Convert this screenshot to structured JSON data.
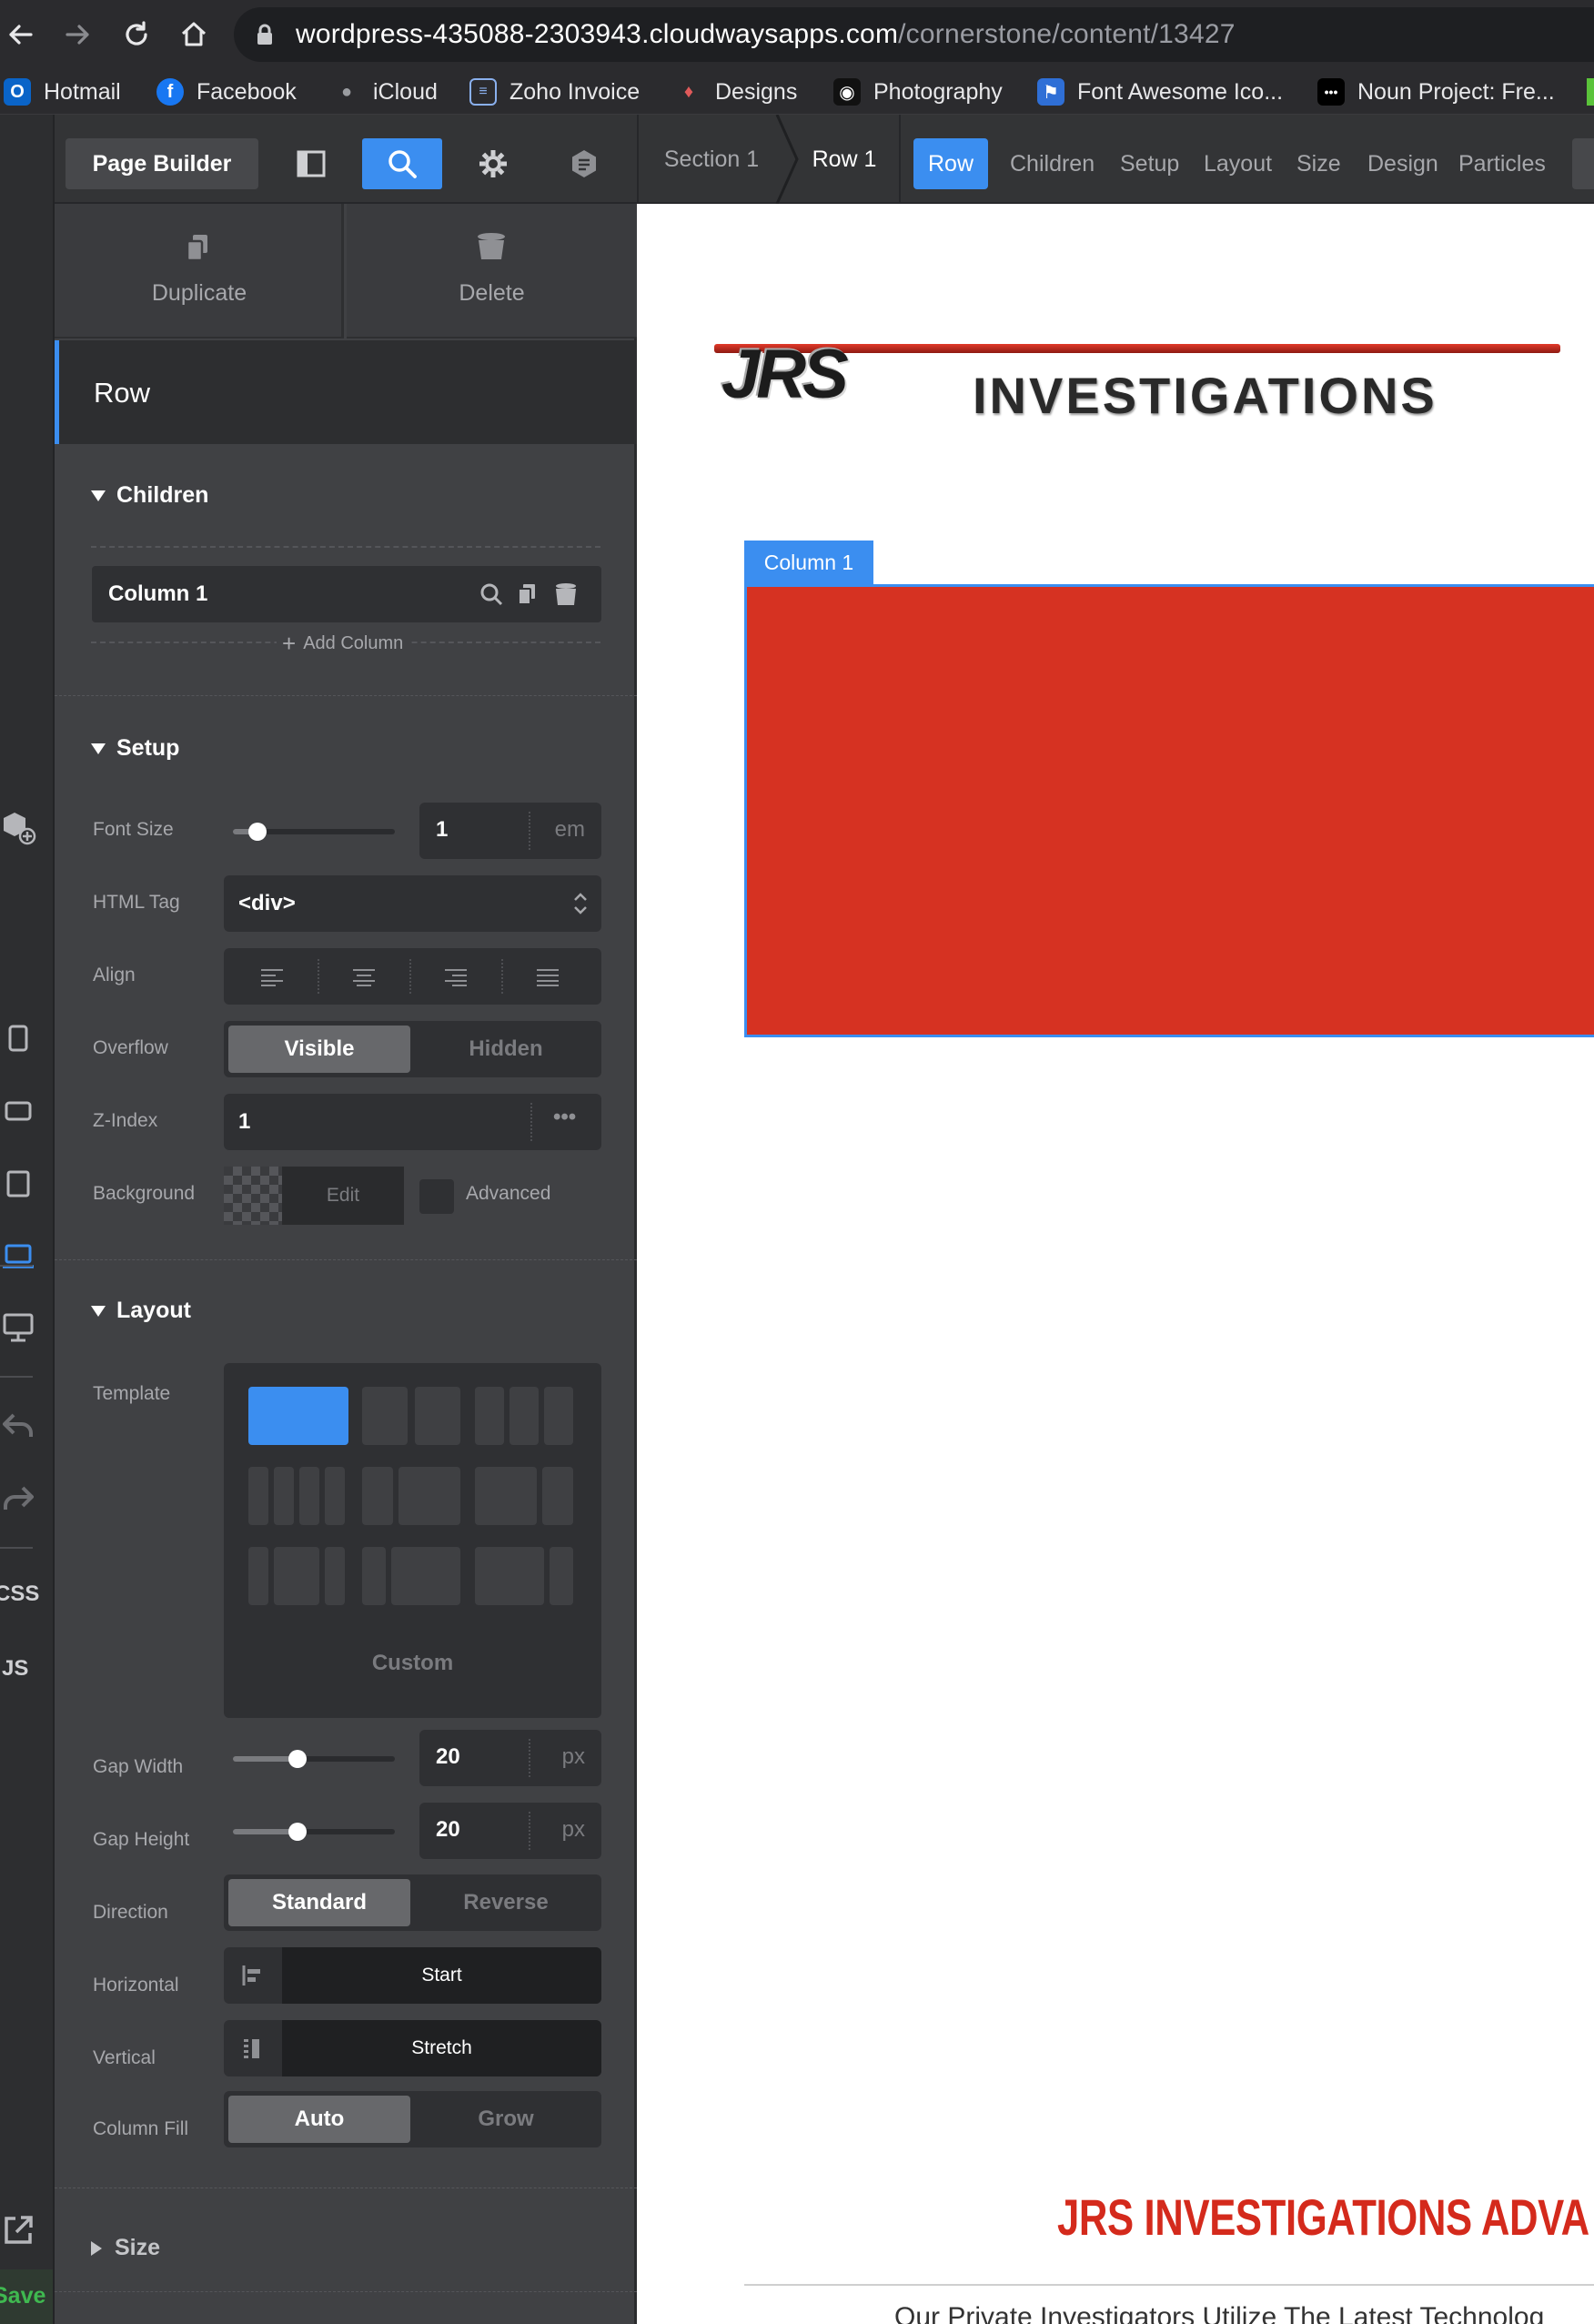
{
  "browser": {
    "url_host": "wordpress-435088-2303943.cloudwaysapps.com",
    "url_path": "/cornerstone/content/13427",
    "bookmarks": [
      {
        "label": "Hotmail",
        "icon": "outlook-icon",
        "color": "#0a64c8"
      },
      {
        "label": "Facebook",
        "icon": "facebook-icon",
        "color": "#1877f2"
      },
      {
        "label": "iCloud",
        "icon": "apple-icon",
        "color": "#8e8e93"
      },
      {
        "label": "Zoho Invoice",
        "icon": "invoice-icon",
        "color": "#4a7bd8"
      },
      {
        "label": "Designs",
        "icon": "lightbulb-icon",
        "color": "#e05a5a"
      },
      {
        "label": "Photography",
        "icon": "camera-icon",
        "color": "#111111"
      },
      {
        "label": "Font Awesome Ico...",
        "icon": "flag-icon",
        "color": "#2f6fd6"
      },
      {
        "label": "Noun Project: Fre...",
        "icon": "noun-project-icon",
        "color": "#000000"
      }
    ]
  },
  "toolbar": {
    "page_builder_label": "Page Builder",
    "breadcrumbs": [
      "Section 1",
      "Row 1"
    ],
    "tabs": [
      "Row",
      "Children",
      "Setup",
      "Layout",
      "Size",
      "Design",
      "Particles"
    ],
    "active_tab": "Row",
    "accent": "#3b8ef0"
  },
  "rail": {
    "css_label": "CSS",
    "js_label": "JS",
    "save_label": "Save",
    "save_color": "#3fb950"
  },
  "panel": {
    "duplicate_label": "Duplicate",
    "delete_label": "Delete",
    "title": "Row",
    "children": {
      "heading": "Children",
      "items": [
        "Column 1"
      ],
      "add_label": "Add Column"
    },
    "setup": {
      "heading": "Setup",
      "font_size": {
        "label": "Font Size",
        "value": "1",
        "unit": "em",
        "level": 0.15
      },
      "html_tag": {
        "label": "HTML Tag",
        "value": "<div>"
      },
      "align": {
        "label": "Align"
      },
      "overflow": {
        "label": "Overflow",
        "options": [
          "Visible",
          "Hidden"
        ],
        "selected": "Visible"
      },
      "z_index": {
        "label": "Z-Index",
        "value": "1"
      },
      "background": {
        "label": "Background",
        "edit_label": "Edit",
        "advanced_label": "Advanced"
      }
    },
    "layout": {
      "heading": "Layout",
      "template_label": "Template",
      "custom_label": "Custom",
      "gap_width": {
        "label": "Gap Width",
        "value": "20",
        "unit": "px",
        "level": 0.4
      },
      "gap_height": {
        "label": "Gap Height",
        "value": "20",
        "unit": "px",
        "level": 0.4
      },
      "direction": {
        "label": "Direction",
        "options": [
          "Standard",
          "Reverse"
        ],
        "selected": "Standard"
      },
      "horizontal": {
        "label": "Horizontal",
        "value": "Start"
      },
      "vertical": {
        "label": "Vertical",
        "value": "Stretch"
      },
      "column_fill": {
        "label": "Column Fill",
        "options": [
          "Auto",
          "Grow"
        ],
        "selected": "Auto"
      }
    },
    "size": {
      "heading": "Size"
    }
  },
  "canvas": {
    "logo_text_left": "JRS",
    "logo_text_right": "INVESTIGATIONS",
    "column_tag": "Column 1",
    "column_color": "#d63222",
    "heading": "JRS INVESTIGATIONS ADVA",
    "heading_color": "#d42a1c",
    "subtext": "Our Private Investigators Utilize The Latest Technolog"
  }
}
